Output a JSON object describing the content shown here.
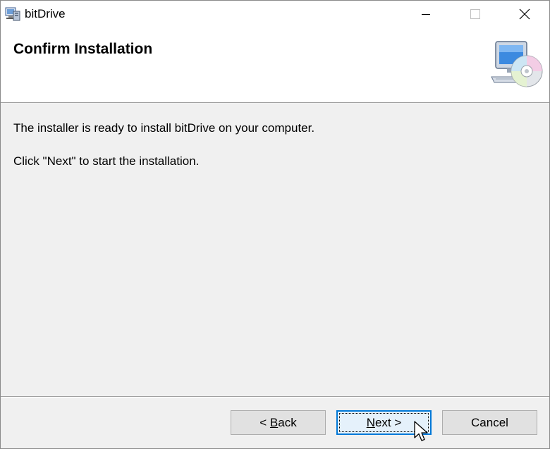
{
  "window": {
    "title": "bitDrive",
    "controls": {
      "minimize": "minimize",
      "maximize": "maximize",
      "close": "close"
    }
  },
  "header": {
    "title": "Confirm Installation",
    "graphic": "computer-cd-icon"
  },
  "body": {
    "line1": "The installer is ready to install bitDrive on your computer.",
    "line2": "Click \"Next\" to start the installation."
  },
  "buttons": {
    "back": {
      "prefix": "< ",
      "mnemonic": "B",
      "rest": "ack"
    },
    "next": {
      "mnemonic": "N",
      "rest": "ext >"
    },
    "cancel": {
      "label": "Cancel"
    }
  },
  "colors": {
    "focus_border": "#0078d7",
    "button_face": "#e1e1e1",
    "dialog_bg": "#f0f0f0"
  }
}
